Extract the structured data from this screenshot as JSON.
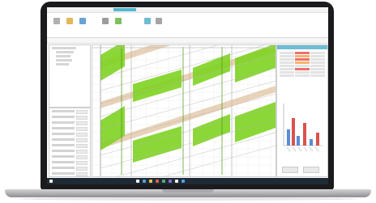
{
  "colors": {
    "accent": "#55b7d0",
    "band_green": "#7ed321",
    "band_green_dark": "#4e9a12",
    "band_tan": "#d8b48a",
    "grid_line": "#c9c9c9",
    "bar_red": "#d9534f",
    "bar_blue": "#5b8dd6",
    "taskbar": "#1e2a35"
  },
  "ribbon": {
    "buttons": [
      {
        "icon": "file-icon",
        "color": "#b0b0b0"
      },
      {
        "icon": "open-icon",
        "color": "#e2b75a"
      },
      {
        "icon": "save-icon",
        "color": "#6aa3d6"
      },
      {
        "icon": "settings-icon",
        "color": "#9c9c9c"
      },
      {
        "icon": "calc-icon",
        "color": "#7fbf5f"
      },
      {
        "icon": "export-icon",
        "color": "#6fbcd3"
      },
      {
        "icon": "report-icon",
        "color": "#a5a5a5"
      }
    ]
  },
  "taskbar_icons": [
    "#ffffff",
    "#4aa3df",
    "#f2c14e",
    "#e35d4f",
    "#4fb06d",
    "#8a6fd1",
    "#ffffff",
    "#4aa3df"
  ]
}
